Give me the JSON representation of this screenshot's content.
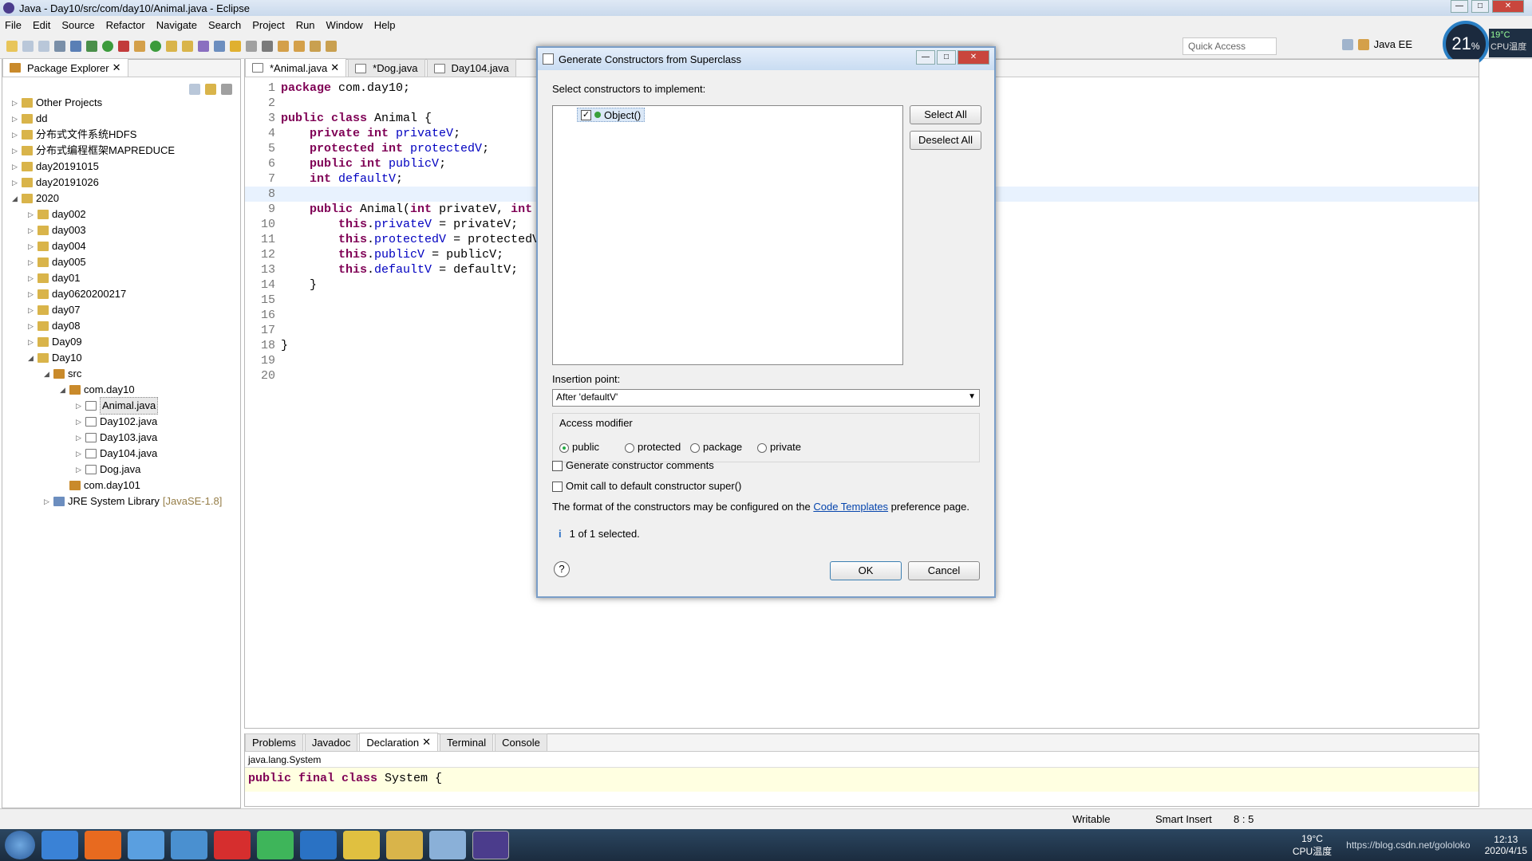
{
  "window": {
    "title": "Java - Day10/src/com/day10/Animal.java - Eclipse"
  },
  "menu": [
    "File",
    "Edit",
    "Source",
    "Refactor",
    "Navigate",
    "Search",
    "Project",
    "Run",
    "Window",
    "Help"
  ],
  "quick_access": "Quick Access",
  "perspective": "Java EE",
  "cpu": {
    "percent": "21",
    "unit": "%",
    "temp": "19°C",
    "label": "CPU温度"
  },
  "package_explorer": {
    "title": "Package Explorer",
    "items": [
      {
        "label": "Other Projects",
        "depth": 0,
        "exp": "▷",
        "icon": "proj"
      },
      {
        "label": "dd",
        "depth": 0,
        "exp": "▷",
        "icon": "proj"
      },
      {
        "label": "分布式文件系统HDFS",
        "depth": 0,
        "exp": "▷",
        "icon": "proj"
      },
      {
        "label": "分布式编程框架MAPREDUCE",
        "depth": 0,
        "exp": "▷",
        "icon": "proj"
      },
      {
        "label": "day20191015",
        "depth": 0,
        "exp": "▷",
        "icon": "proj"
      },
      {
        "label": "day20191026",
        "depth": 0,
        "exp": "▷",
        "icon": "proj"
      },
      {
        "label": "2020",
        "depth": 0,
        "exp": "◢",
        "icon": "proj"
      },
      {
        "label": "day002",
        "depth": 1,
        "exp": "▷",
        "icon": "proj"
      },
      {
        "label": "day003",
        "depth": 1,
        "exp": "▷",
        "icon": "proj"
      },
      {
        "label": "day004",
        "depth": 1,
        "exp": "▷",
        "icon": "proj"
      },
      {
        "label": "day005",
        "depth": 1,
        "exp": "▷",
        "icon": "proj"
      },
      {
        "label": "day01",
        "depth": 1,
        "exp": "▷",
        "icon": "proj"
      },
      {
        "label": "day0620200217",
        "depth": 1,
        "exp": "▷",
        "icon": "proj"
      },
      {
        "label": "day07",
        "depth": 1,
        "exp": "▷",
        "icon": "proj"
      },
      {
        "label": "day08",
        "depth": 1,
        "exp": "▷",
        "icon": "proj"
      },
      {
        "label": "Day09",
        "depth": 1,
        "exp": "▷",
        "icon": "proj"
      },
      {
        "label": "Day10",
        "depth": 1,
        "exp": "◢",
        "icon": "proj"
      },
      {
        "label": "src",
        "depth": 2,
        "exp": "◢",
        "icon": "pkg"
      },
      {
        "label": "com.day10",
        "depth": 3,
        "exp": "◢",
        "icon": "pkg"
      },
      {
        "label": "Animal.java",
        "depth": 4,
        "exp": "▷",
        "icon": "jfile"
      },
      {
        "label": "Day102.java",
        "depth": 4,
        "exp": "▷",
        "icon": "jfile"
      },
      {
        "label": "Day103.java",
        "depth": 4,
        "exp": "▷",
        "icon": "jfile"
      },
      {
        "label": "Day104.java",
        "depth": 4,
        "exp": "▷",
        "icon": "jfile"
      },
      {
        "label": "Dog.java",
        "depth": 4,
        "exp": "▷",
        "icon": "jfile"
      },
      {
        "label": "com.day101",
        "depth": 3,
        "exp": "",
        "icon": "pkg"
      },
      {
        "label": "JRE System Library",
        "suffix": "[JavaSE-1.8]",
        "depth": 2,
        "exp": "▷",
        "icon": "jre"
      }
    ]
  },
  "editor": {
    "tabs": [
      "*Animal.java",
      "*Dog.java",
      "Day104.java"
    ],
    "lines": [
      [
        {
          "t": "package ",
          "c": "kw"
        },
        {
          "t": "com.day10;"
        }
      ],
      [],
      [
        {
          "t": "public ",
          "c": "kw"
        },
        {
          "t": "class ",
          "c": "kw"
        },
        {
          "t": "Animal {"
        }
      ],
      [
        {
          "t": "    "
        },
        {
          "t": "private ",
          "c": "kw"
        },
        {
          "t": "int ",
          "c": "kw"
        },
        {
          "t": "privateV",
          "c": "fd"
        },
        {
          "t": ";"
        }
      ],
      [
        {
          "t": "    "
        },
        {
          "t": "protected ",
          "c": "kw"
        },
        {
          "t": "int ",
          "c": "kw"
        },
        {
          "t": "protectedV",
          "c": "fd"
        },
        {
          "t": ";"
        }
      ],
      [
        {
          "t": "    "
        },
        {
          "t": "public ",
          "c": "kw"
        },
        {
          "t": "int ",
          "c": "kw"
        },
        {
          "t": "publicV",
          "c": "fd"
        },
        {
          "t": ";"
        }
      ],
      [
        {
          "t": "    "
        },
        {
          "t": "int ",
          "c": "kw"
        },
        {
          "t": "defaultV",
          "c": "fd"
        },
        {
          "t": ";"
        }
      ],
      [],
      [
        {
          "t": "    "
        },
        {
          "t": "public ",
          "c": "kw"
        },
        {
          "t": "Animal("
        },
        {
          "t": "int ",
          "c": "kw"
        },
        {
          "t": "privateV, "
        },
        {
          "t": "int",
          "c": "kw"
        }
      ],
      [
        {
          "t": "        "
        },
        {
          "t": "this",
          "c": "kw"
        },
        {
          "t": "."
        },
        {
          "t": "privateV",
          "c": "fd"
        },
        {
          "t": " = privateV;"
        }
      ],
      [
        {
          "t": "        "
        },
        {
          "t": "this",
          "c": "kw"
        },
        {
          "t": "."
        },
        {
          "t": "protectedV",
          "c": "fd"
        },
        {
          "t": " = protectedV"
        }
      ],
      [
        {
          "t": "        "
        },
        {
          "t": "this",
          "c": "kw"
        },
        {
          "t": "."
        },
        {
          "t": "publicV",
          "c": "fd"
        },
        {
          "t": " = publicV;"
        }
      ],
      [
        {
          "t": "        "
        },
        {
          "t": "this",
          "c": "kw"
        },
        {
          "t": "."
        },
        {
          "t": "defaultV",
          "c": "fd"
        },
        {
          "t": " = defaultV;"
        }
      ],
      [
        {
          "t": "    }"
        }
      ],
      [],
      [],
      [],
      [
        {
          "t": "}"
        }
      ],
      [],
      []
    ]
  },
  "bottom": {
    "tabs": [
      "Problems",
      "Javadoc",
      "Declaration",
      "Terminal",
      "Console"
    ],
    "decl_path": "java.lang.System",
    "decl_code_kw": "public final class",
    "decl_code_rest": " System {"
  },
  "status": {
    "writable": "Writable",
    "insert": "Smart Insert",
    "pos": "8 : 5"
  },
  "dialog": {
    "title": "Generate Constructors from Superclass",
    "prompt": "Select constructors to implement:",
    "constructor": "Object()",
    "select_all": "Select All",
    "deselect_all": "Deselect All",
    "insertion_label": "Insertion point:",
    "insertion_value": "After 'defaultV'",
    "access_label": "Access modifier",
    "radios": [
      "public",
      "protected",
      "package",
      "private"
    ],
    "opt_comments": "Generate constructor comments",
    "opt_omit": "Omit call to default constructor super()",
    "format_pre": "The format of the constructors may be configured on the ",
    "format_link": "Code Templates",
    "format_post": " preference page.",
    "info": "1 of 1 selected.",
    "ok": "OK",
    "cancel": "Cancel"
  },
  "taskbar": {
    "temp": "19°C",
    "cpu_label": "CPU温度",
    "time": "12:13",
    "date": "2020/4/15",
    "watermark": "https://blog.csdn.net/gololoko"
  }
}
